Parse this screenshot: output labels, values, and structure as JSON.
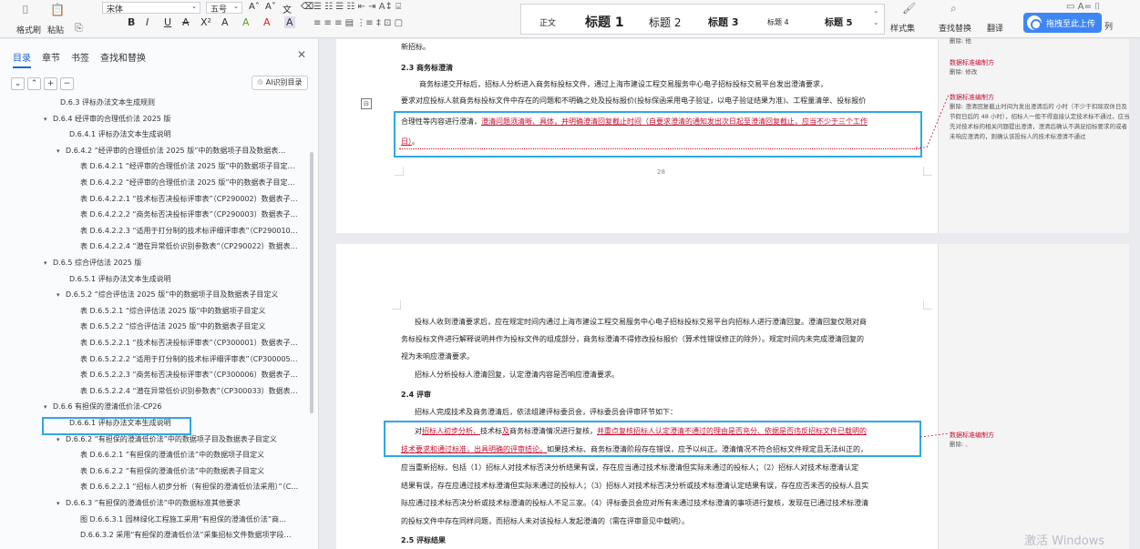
{
  "ribbon": {
    "clipboard": {
      "format_painter": "格式刷",
      "paste": "粘贴"
    },
    "font": {
      "name": "宋体",
      "size": "五号"
    },
    "font_buttons": [
      "B",
      "I",
      "U",
      "A",
      "X²",
      "A",
      "A",
      "A",
      "A"
    ],
    "styles": [
      "正文",
      "标题 1",
      "标题 2",
      "标题 3",
      "标题 4",
      "标题 5"
    ],
    "style_set": "样式集",
    "find_replace": "查找替换",
    "translate": "翻译",
    "upload": "拖拽至此上传",
    "more": "列"
  },
  "sidebar": {
    "tabs": [
      "目录",
      "章节",
      "书签",
      "查找和替换"
    ],
    "active_tab": "目录",
    "ai_button": "AI识别目录",
    "controls": [
      "⌄",
      "⌃",
      "+",
      "−"
    ],
    "toc": [
      "D.6.3 评标办法文本生成规则",
      "D.6.4 经评审的合理低价法 2025 版",
      "D.6.4.1 评标办法文本生成说明",
      "D.6.4.2 “经评审的合理低价法 2025 版”中的数据项子目及数据表…",
      "表 D.6.4.2.1 “经评审的合理低价法 2025 版”中的数据项子目定…",
      "表 D.6.4.2.2 “经评审的合理低价法 2025 版”中的数据表子目定…",
      "表 D.6.4.2.2.1 “技术标否决投标评审表”（CP290002）数据表子…",
      "表 D.6.4.2.2.2 “商务标否决投标评审表”（CP290003）数据表子…",
      "表 D.6.4.2.2.3 “适用于打分制的技术标评细评审表”（CP290010…",
      "表 D.6.4.2.2.4 “潜在异常低价识别参数表”（CP290022）数据表…",
      "D.6.5 综合评估法 2025 版",
      "D.6.5.1 评标办法文本生成说明",
      "D.6.5.2 “综合评估法 2025 版”中的数据项子目及数据表子目定义",
      "表 D.6.5.2.1 “综合评估法 2025 版”中的数据项子目定义",
      "表 D.6.5.2.2 “综合评估法 2025 版”中的数据表子目定义",
      "表 D.6.5.2.2.1 “技术标否决投标评审表”（CP300001）数据表子…",
      "表 D.6.5.2.2.2 “适用于打分制的技术标评细评审表”（CP300005…",
      "表 D.6.5.2.2.3 “商务标否决投标评审表”（CP300006）数据表子…",
      "表 D.6.5.2.2.4 “潜在异常低价识别参数表”（CP300033）数据表…",
      "D.6.6 有担保的澄清低价法-CP26",
      "D.6.6.1 评标办法文本生成说明",
      "D.6.6.2 “有担保的澄清低价法”中的数据项子目及数据表子目定义",
      "表 D.6.6.2.1 “有担保的澄清低价法”中的数据项子目定义",
      "表 D.6.6.2.2 “有担保的澄清低价法”中的数据表子目定义",
      "表 D.6.6.2.2.1 “招标人初步分析（有担保的澄清低价法采用）”（C…",
      "D.6.6.3 “有担保的澄清低价法”中的数据标准其他要求",
      "图 D.6.6.3.1 园林绿化工程施工采用“有担保的澄清低价法”商…",
      "D.6.6.3.2 采用“有担保的澄清低价法”采集招标文件数据项字段…"
    ]
  },
  "page1": {
    "line0": "新招标。",
    "heading": "2.3 商务标澄清",
    "para1": "商务标递交开标后，招标人分析进入商务标投标文件，通过上海市建设工程交易服务中心电子招标投标交易平台发出澄清要求，",
    "para2": "要求对应投标人就商务标投标文件中存在的问题和不明确之处及投标报价(投标保函采用电子验证，以电子验证结果为准)、工程量清单、投标报价",
    "para3_plain": "合理性等内容进行澄清，",
    "para3_ins": "澄清问题须清晰、具体，并明确澄清回复截止时间（自要求澄清的通知发出次日起至澄清回复截止，应当不少于三个工作",
    "para4_ins": "日）",
    "para4_end": "。",
    "page_number": "28"
  },
  "page2": {
    "p1": "投标人收到澄清要求后，应在规定时间内通过上海市建设工程交易服务中心电子招标投标交易平台向招标人进行澄清回复。澄清回复仅限对商",
    "p2": "务标投标文件进行解释说明并作为投标文件的组成部分，商务标澄清不得修改投标报价（算术性错误修正的除外）。规定时间内未完成澄清回复的",
    "p3": "视为未响应澄清要求。",
    "p4": "招标人分析投标人澄清回复，认定澄清内容是否响应澄清要求。",
    "h_review": "2.4 评审",
    "p5": "招标人完成技术及商务澄清后，依法组建评标委员会，评标委员会评审环节如下：",
    "p6_pre": "对",
    "p6_ins1": "招标人初步分析、",
    "p6_mid": "技术标",
    "p6_ins2": "及",
    "p6_mid2": "商务标澄清情况进行复核，",
    "p6_ins3": "并重点复核招标人认定澄清不通过的理由是否充分、依据是否违反招标文件已载明的",
    "p7_ins": "技术要求和通过标准，出具明确的评审结论。",
    "p7_rest": "如果技术标、商务标澄清阶段存在错误，应予以纠正。澄清情况不符合招标文件规定且无法纠正的，",
    "p8": "应当重新招标，包括（1）招标人对技术标否决分析结果有误，存在应当通过技术标澄清但实际未通过的投标人；（2）招标人对技术标澄清认定",
    "p9": "结果有误，存在应通过技术标澄清但实际未通过的投标人；（3）招标人对技术标否决分析或技术标澄清认定结果有误，存在应否未否的投标人且实",
    "p10": "际应通过技术标否决分析或技术标澄清的投标人不足三家。（4）评标委员会应对所有未通过技术标澄清的事项进行复核，发现在已通过技术标澄清",
    "p11": "的投标文件中存在同样问题，而招标人未对该投标人发起澄清的（需在评审意见中载明）。",
    "h_result": "2.5 评标结果"
  },
  "comments": {
    "c0_tail": "删除: 他",
    "c1_head": "数据标准编制方",
    "c1_body": "删除: 修改",
    "c2_head": "数据标准编制方",
    "c2_body": "删除: 澄清回复截止时间为发出澄清后的   小时（不少于扣除双休日及节假日后的 48 小时），招标人一般不得直接认定技术标不通过，应当先对技术标的相关问题提出澄清，澄清后确认不满足招标要求的或者未响应澄清的，则确认该投标人的技术标澄清不通过",
    "c3_head": "数据标准编制方",
    "c3_body": "删除: 、"
  },
  "watermark": "激活 Windows"
}
